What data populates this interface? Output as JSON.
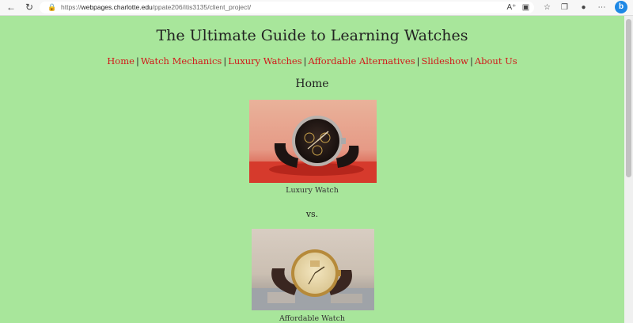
{
  "browser": {
    "url_scheme": "https://",
    "url_host": "webpages.charlotte.edu",
    "url_path": "/ppate206/itis3135/client_project/"
  },
  "page": {
    "title": "The Ultimate Guide to Learning Watches",
    "nav": [
      "Home",
      "Watch Mechanics",
      "Luxury Watches",
      "Affordable Alternatives",
      "Slideshow",
      "About Us"
    ],
    "nav_separator": "|",
    "heading": "Home",
    "luxury_caption": "Luxury Watch",
    "vs_text": "vs.",
    "affordable_caption": "Affordable Watch"
  },
  "colors": {
    "background": "#a8e69b",
    "link": "#d11a1a"
  },
  "icons": {
    "back": "back-arrow-icon",
    "reload": "reload-icon",
    "lock": "lock-icon",
    "read_aloud": "read-aloud-icon",
    "tracking": "tracking-prevention-icon",
    "favorites": "favorites-icon",
    "collections": "collections-icon",
    "profile": "profile-icon",
    "menu": "more-menu-icon",
    "copilot": "bing-copilot-icon"
  }
}
